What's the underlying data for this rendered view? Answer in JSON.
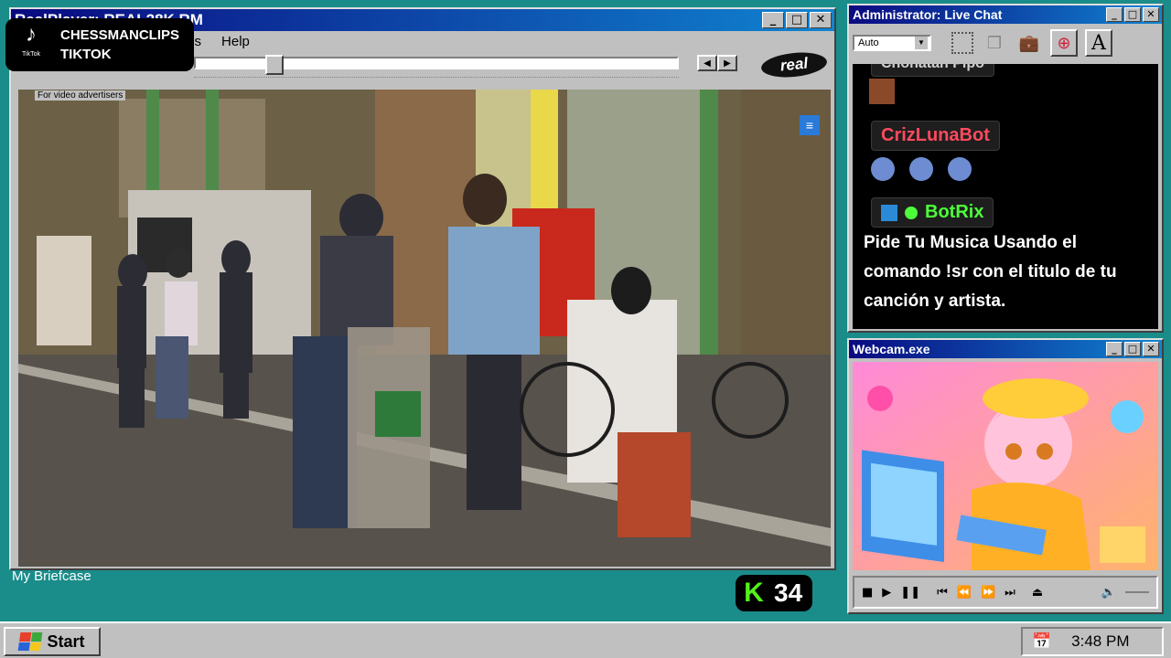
{
  "realplayer": {
    "title": "RealPlayer: REAL28K.RM",
    "menu": [
      "Favorites",
      "Help"
    ],
    "menu_visible": [
      "tes",
      "Help"
    ],
    "overlay_label": "For video advertisers",
    "logo_text": "real",
    "seek_fraction": 0.15
  },
  "overlay": {
    "brand": "CHESSMANCLIPS",
    "platform": "TIKTOK",
    "logo_caption": "TikTok"
  },
  "chat": {
    "title": "Administrator: Live Chat",
    "font_select": "Auto",
    "partial_user": "Chonatan Pipo",
    "users": [
      {
        "name": "CrizLunaBot",
        "color": "#ff4a5e"
      },
      {
        "name": "BotRix",
        "color": "#4dff3a"
      }
    ],
    "message": "Pide Tu Musica Usando el comando !sr con el titulo de tu canción y artista.",
    "toolbar_font_icon": "A"
  },
  "webcam": {
    "title": "Webcam.exe"
  },
  "desktop": {
    "briefcase_label": "My Briefcase",
    "kick_count": "34",
    "kick_letter": "K"
  },
  "taskbar": {
    "start_label": "Start",
    "time": "3:48 PM"
  },
  "colors": {
    "desktop": "#1a8c8a",
    "title_active": "#0a0a80",
    "kick_green": "#52f21a"
  }
}
